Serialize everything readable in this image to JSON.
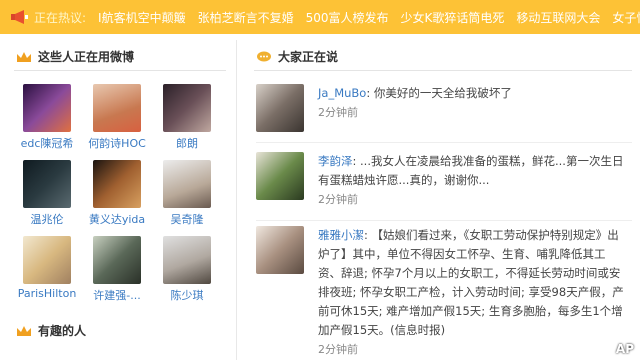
{
  "hotbar": {
    "label": "正在热议:",
    "items": [
      "I航客机空中颠簸",
      "张柏芝断言不复婚",
      "500富人榜发布",
      "少女K歌猝话筒电死",
      "移动互联网大会",
      "女子怀孕"
    ]
  },
  "left": {
    "section_title": "这些人正在用微博",
    "users": [
      {
        "name": "edc陳冠希",
        "color": "#6a3a7a"
      },
      {
        "name": "何韵诗HOC",
        "color": "#c87850"
      },
      {
        "name": "郎朗",
        "color": "#4a3a40"
      },
      {
        "name": "温兆伦",
        "color": "#1f2a2e"
      },
      {
        "name": "黄义达yida",
        "color": "#8a6040"
      },
      {
        "name": "吴奇隆",
        "color": "#c0b0a0"
      },
      {
        "name": "ParisHilton",
        "color": "#d8c098"
      },
      {
        "name": "许建强-...",
        "color": "#5a6858"
      },
      {
        "name": "陈少琪",
        "color": "#a8a8a8"
      }
    ],
    "section2_title": "有趣的人"
  },
  "right": {
    "section_title": "大家正在说",
    "posts": [
      {
        "author": "Ja_MuBo",
        "text": ": 你美好的一天全给我破坏了",
        "time": "2分钟前",
        "color": "#6a6058"
      },
      {
        "author": "李韵泽",
        "text": ": ...我女人在凌晨给我准备的蛋糕，鲜花...第一次生日有蛋糕蜡烛许愿...真的，谢谢你...",
        "time": "2分钟前",
        "color": "#4a6a3a"
      },
      {
        "author": "雅雅小潔",
        "text": ": 【姑娘们看过来，《女职工劳动保护特别规定》出炉了】其中，单位不得因女工怀孕、生育、哺乳降低其工资、辞退; 怀孕7个月以上的女职工，不得延长劳动时间或安排夜班; 怀孕女职工产检，计入劳动时间; 享受98天产假，产前可休15天; 难产增加产假15天; 生育多胞胎，每多生1个增加产假15天。(信息时报)",
        "time": "2分钟前",
        "color": "#8a7868"
      }
    ]
  },
  "watermark": "AP"
}
